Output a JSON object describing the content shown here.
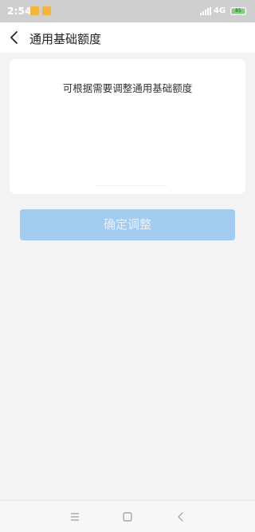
{
  "status_bar": {
    "time": "2:54",
    "network": "4G",
    "battery": "85"
  },
  "header": {
    "title": "通用基础额度",
    "back_icon": "chevron-left-icon"
  },
  "card": {
    "hint": "可根据需要调整通用基础额度"
  },
  "actions": {
    "confirm_label": "确定调整",
    "confirm_color": "#a2ccf0"
  },
  "nav_bar": {
    "icons": [
      "menu-icon",
      "home-icon",
      "back-icon"
    ]
  },
  "colors": {
    "background": "#f3f3f3",
    "status_bar": "#cfcfcf",
    "notification": "#f3b43c",
    "battery": "#7ed07a"
  }
}
